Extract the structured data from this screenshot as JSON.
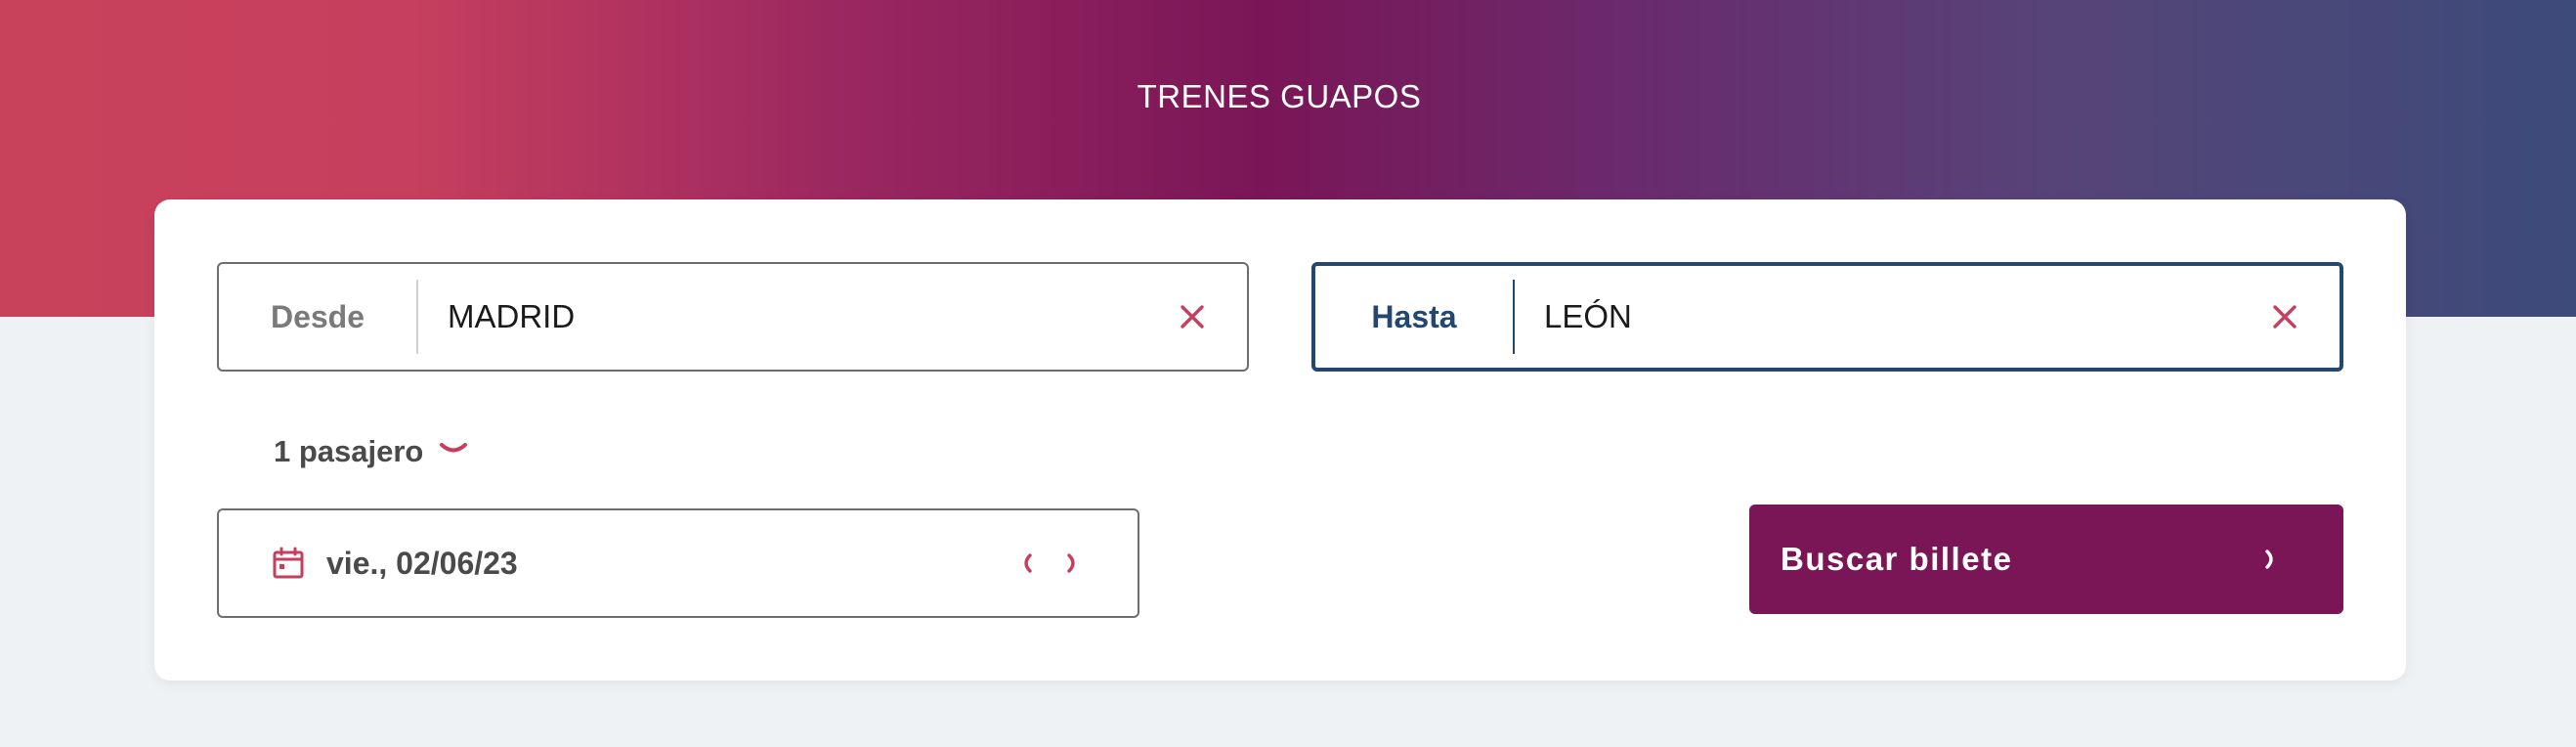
{
  "header": {
    "brand": "TRENES GUAPOS"
  },
  "search_form": {
    "from": {
      "label": "Desde",
      "value": "MADRID",
      "clear_icon": "close-icon"
    },
    "to": {
      "label": "Hasta",
      "value": "LEÓN",
      "clear_icon": "close-icon"
    },
    "passengers": {
      "label": "1 pasajero",
      "icon": "chevron-down-icon"
    },
    "date": {
      "value": "vie., 02/06/23",
      "icon": "calendar-icon",
      "prev_icon": "chevron-left-icon",
      "next_icon": "chevron-right-icon"
    },
    "submit": {
      "label": "Buscar billete",
      "icon": "chevron-right-icon"
    }
  },
  "colors": {
    "accent": "#c63f5e",
    "primary": "#7a1556",
    "focus": "#24476f"
  }
}
